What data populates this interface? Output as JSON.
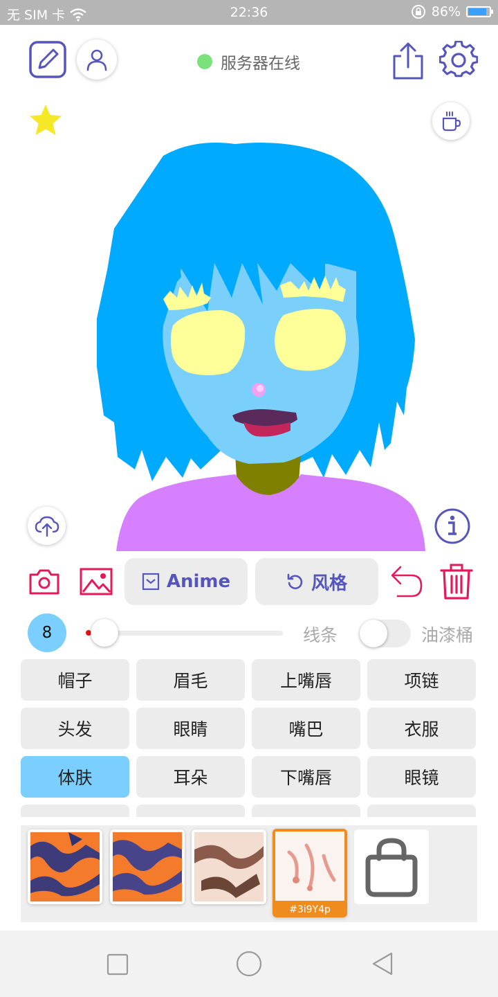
{
  "status_bar": {
    "carrier": "无 SIM 卡",
    "time": "22:36",
    "battery": "86%",
    "battery_level": 0.86
  },
  "toolbar": {
    "server_status": "服务器在线",
    "server_status_color": "#7be27b"
  },
  "actions": {
    "anime_label": "Anime",
    "style_label": "风格"
  },
  "brush": {
    "size": "8",
    "line_label": "线条",
    "bucket_label": "油漆桶",
    "bucket_enabled": false
  },
  "categories": [
    {
      "label": "帽子"
    },
    {
      "label": "眉毛"
    },
    {
      "label": "上嘴唇"
    },
    {
      "label": "项链"
    },
    {
      "label": "头发"
    },
    {
      "label": "眼睛"
    },
    {
      "label": "嘴巴"
    },
    {
      "label": "衣服"
    },
    {
      "label": "体肤",
      "active": true
    },
    {
      "label": "耳朵"
    },
    {
      "label": "下嘴唇"
    },
    {
      "label": "眼镜"
    }
  ],
  "styles": {
    "selected_code": "#3i9Y4p"
  },
  "colors": {
    "accent": "#5555bb",
    "red_icons": "#e5195a",
    "hair": "#00aaff",
    "skin": "#7acffb",
    "eyes": "#ffff99",
    "shirt": "#d780ff",
    "neck": "#808000",
    "active_category": "#7bcfff",
    "selected_style": "#f08c1e"
  }
}
